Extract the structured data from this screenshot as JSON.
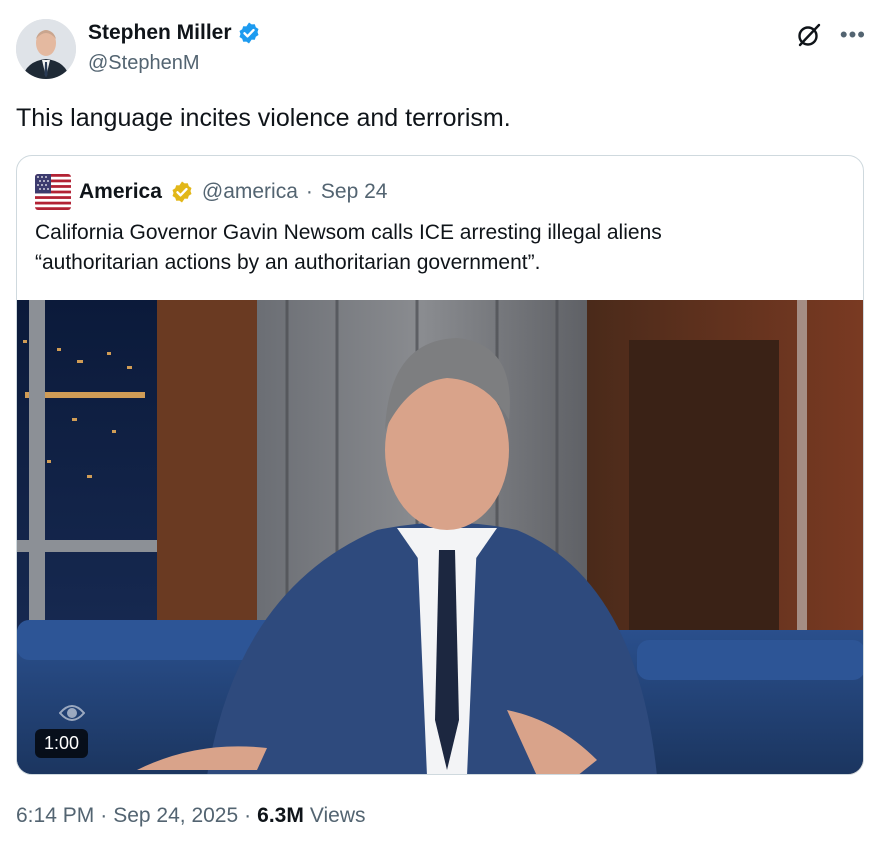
{
  "author": {
    "name": "Stephen Miller",
    "handle": "@StephenM",
    "verified_color": "#1d9bf0"
  },
  "icons": {
    "grok": "grok-icon",
    "more": "more-icon"
  },
  "tweet": {
    "text": "This language incites violence and terrorism."
  },
  "quote": {
    "name": "America",
    "handle": "@america",
    "separator": "·",
    "date": "Sep 24",
    "verified_color": "#e2b719",
    "text_line1": "California Governor Gavin Newsom calls ICE arresting illegal aliens",
    "text_line2": "“authoritarian actions by an authoritarian government”.",
    "video": {
      "duration": "1:00"
    }
  },
  "footer": {
    "time": "6:14 PM",
    "sep1": "·",
    "date": "Sep 24, 2025",
    "sep2": "·",
    "views_count": "6.3M",
    "views_label": "Views"
  }
}
